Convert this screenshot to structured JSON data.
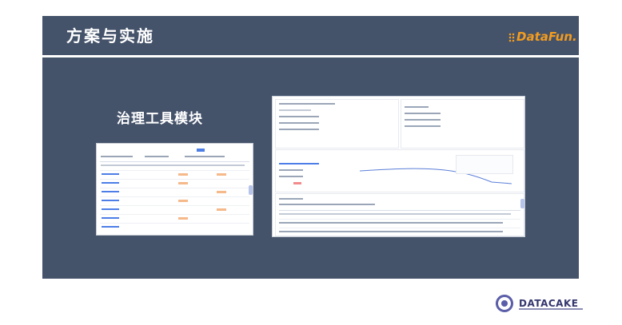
{
  "header": {
    "title": "方案与实施"
  },
  "brand": {
    "datafun": "DataFun.",
    "datacake": "DATACAKE"
  },
  "content": {
    "section_label": "治理工具模块",
    "screenshots": [
      {
        "name": "governance-table-screenshot"
      },
      {
        "name": "governance-detail-screenshot"
      }
    ]
  },
  "colors": {
    "header_bg": "#44526a",
    "accent_orange": "#f39c1f",
    "datacake_purple": "#5b5ea8"
  }
}
